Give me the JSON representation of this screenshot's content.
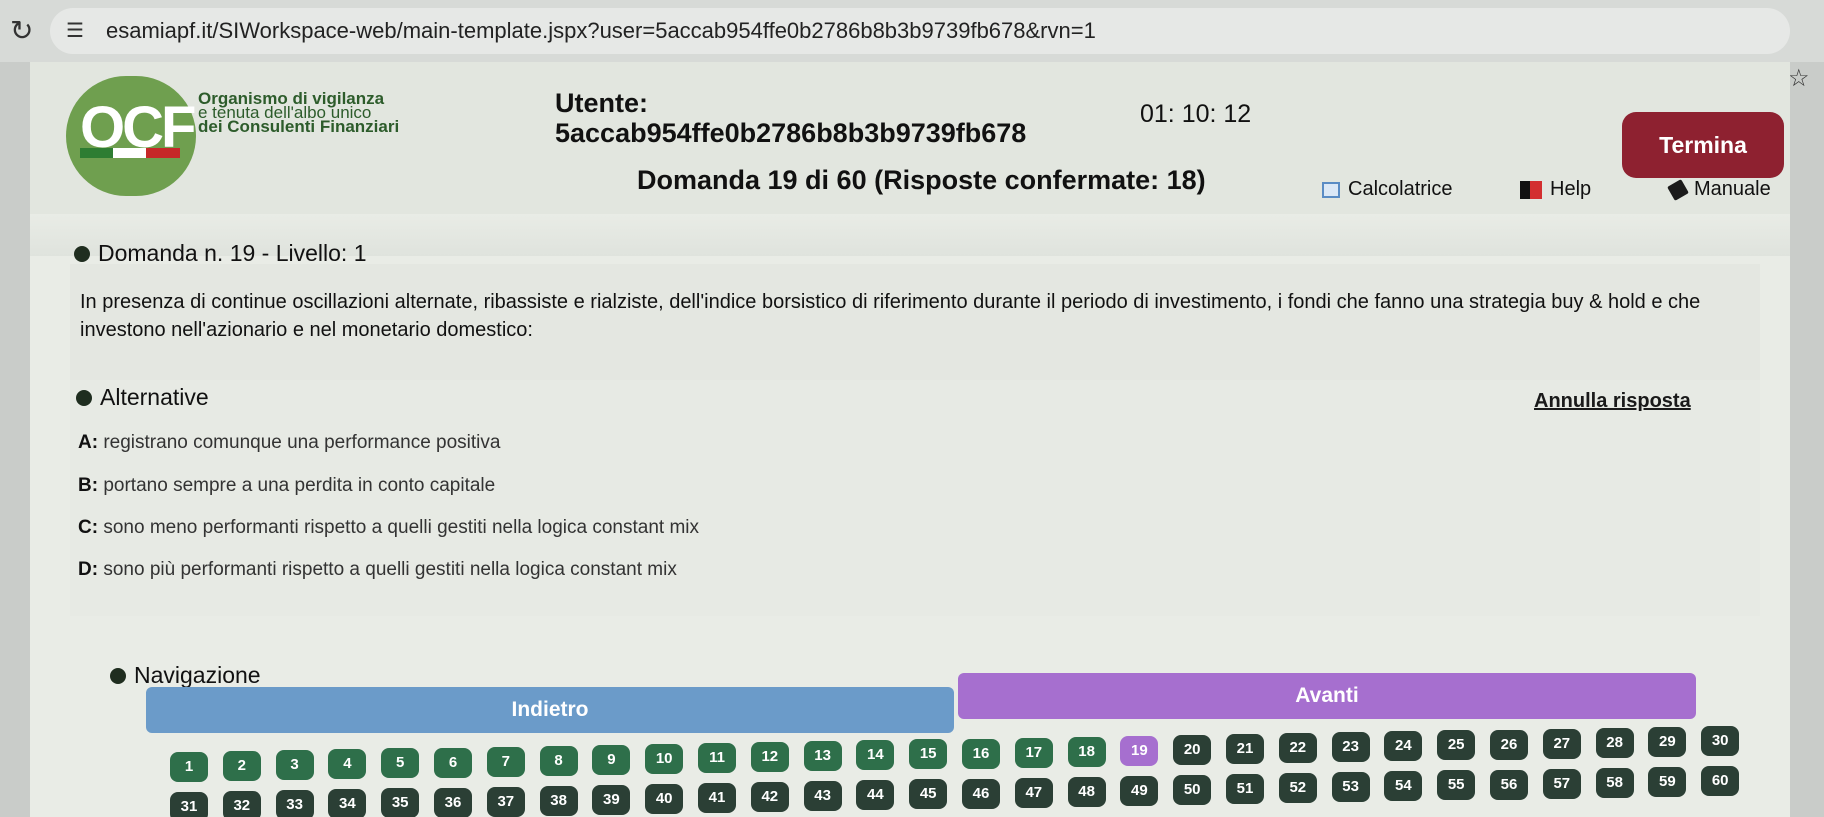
{
  "browser": {
    "url": "esamiapf.it/SIWorkspace-web/main-template.jspx?user=5accab954ffe0b2786b8b3b9739fb678&rvn=1"
  },
  "header": {
    "logo_text": "OCF",
    "org_line1": "Organismo di vigilanza",
    "org_line2": "e tenuta dell'albo unico",
    "org_line3": "dei Consulenti Finanziari",
    "utente_label": "Utente:",
    "utente_value": "5accab954ffe0b2786b8b3b9739fb678",
    "timer": "01: 10: 12",
    "termina_label": "Termina",
    "domanda_status": "Domanda 19 di 60 (Risposte confermate: 18)",
    "tools": {
      "calc_label": "Calcolatrice",
      "help_label": "Help",
      "manual_label": "Manuale"
    }
  },
  "question": {
    "title": "Domanda n. 19 - Livello: 1",
    "text": "In presenza di continue oscillazioni alternate, ribassiste e rialziste, dell'indice borsistico di riferimento durante il periodo di investimento, i fondi che fanno una strategia buy & hold e che investono nell'azionario e nel monetario domestico:"
  },
  "alternatives": {
    "title": "Alternative",
    "annulla_label": "Annulla risposta",
    "items": [
      {
        "letter": "A:",
        "text": "registrano comunque una performance positiva"
      },
      {
        "letter": "B:",
        "text": "portano sempre a una perdita in conto capitale"
      },
      {
        "letter": "C:",
        "text": "sono meno performanti rispetto a quelli gestiti nella logica constant mix"
      },
      {
        "letter": "D:",
        "text": "sono più performanti rispetto a quelli gestiti nella logica constant mix"
      }
    ]
  },
  "navigation": {
    "title": "Navigazione",
    "back_label": "Indietro",
    "next_label": "Avanti",
    "current_question": 19,
    "answered_count": 18,
    "total_questions": 60
  },
  "colors": {
    "termina": "#8e2130",
    "back_button": "#6b9bc9",
    "next_button": "#a66fcf",
    "answered": "#2e6f4a",
    "pending": "#2b3f35",
    "current": "#a66fcf"
  }
}
